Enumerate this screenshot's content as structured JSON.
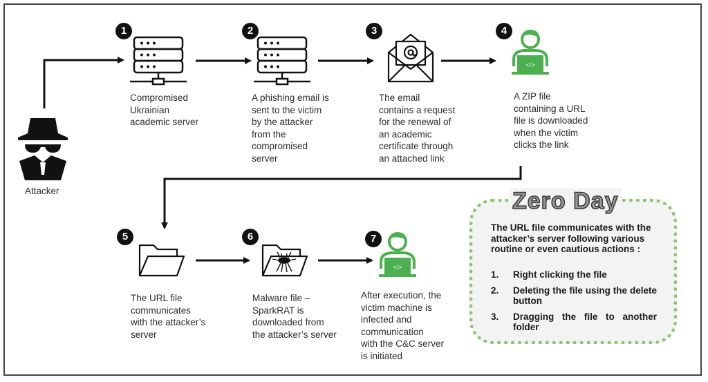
{
  "colors": {
    "victim_green": "#4caf50",
    "border_dark": "#3d4448",
    "zero_day_dotted_border": "#8dc26f",
    "zero_day_box_bg": "#f3f3f3"
  },
  "attacker": {
    "label": "Attacker",
    "icon": "spy-icon"
  },
  "steps": [
    {
      "number": "1",
      "icon": "server-icon",
      "caption": "Compromised\nUkrainian\nacademic server"
    },
    {
      "number": "2",
      "icon": "server-icon",
      "caption": "A phishing email is\nsent to the victim\nby the attacker\nfrom the\ncompromised\nserver"
    },
    {
      "number": "3",
      "icon": "email-envelope-icon",
      "caption": "The email\ncontains a request\nfor the renewal of\nan academic\ncertificate through\nan attached link"
    },
    {
      "number": "4",
      "icon": "victim-coder-icon",
      "caption": "A ZIP file\ncontaining a URL\nfile is downloaded\nwhen the victim\nclicks the link"
    },
    {
      "number": "5",
      "icon": "open-folder-icon",
      "caption": "The URL file\ncommunicates\nwith the attacker’s\nserver"
    },
    {
      "number": "6",
      "icon": "malware-folder-icon",
      "caption": "Malware file –\nSparkRAT is\ndownloaded from\nthe attacker’s server"
    },
    {
      "number": "7",
      "icon": "victim-coder-icon",
      "caption": "After execution, the\nvictim machine  is\ninfected and\ncommunication\nwith the C&C server\nis initiated"
    }
  ],
  "laptop_code_glyph": "</>",
  "zero_day": {
    "title": "Zero Day",
    "intro": "The URL file communicates with the attacker’s server following various routine or even cautious actions :",
    "items": [
      {
        "num": "1.",
        "text": "Right clicking the file"
      },
      {
        "num": "2.",
        "text": "Deleting the file using the delete button"
      },
      {
        "num": "3.",
        "text": "Dragging the file to another folder"
      }
    ]
  }
}
